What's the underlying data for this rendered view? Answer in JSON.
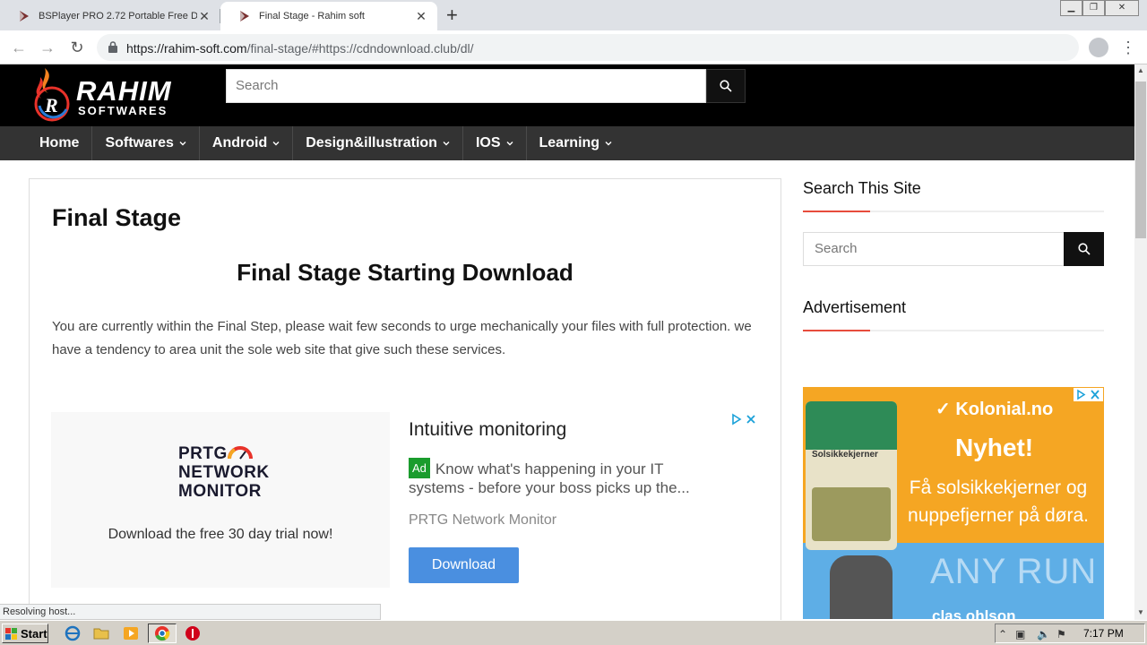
{
  "browser": {
    "tabs": [
      {
        "title": "BSPlayer PRO 2.72 Portable Free Do",
        "active": false
      },
      {
        "title": "Final Stage - Rahim soft",
        "active": true
      }
    ],
    "url_host": "https://rahim-soft.com",
    "url_rest": "/final-stage/#https://cdndownload.club/dl/",
    "status_text": "Resolving host..."
  },
  "site": {
    "logo_name": "RAHIM",
    "logo_sub": "SOFTWARES",
    "header_search_placeholder": "Search",
    "nav": [
      {
        "label": "Home",
        "has_dropdown": false
      },
      {
        "label": "Softwares",
        "has_dropdown": true
      },
      {
        "label": "Android",
        "has_dropdown": true
      },
      {
        "label": "Design&illustration",
        "has_dropdown": true
      },
      {
        "label": "IOS",
        "has_dropdown": true
      },
      {
        "label": "Learning",
        "has_dropdown": true
      }
    ]
  },
  "main": {
    "page_title": "Final Stage",
    "heading": "Final Stage Starting Download",
    "intro": "You are currently within the Final Step, please wait few seconds to urge mechanically your files with full protection. we have a tendency to area unit the sole web site that give such these services."
  },
  "ad": {
    "logo_line1": "PRTG",
    "logo_line2": "NETWORK",
    "logo_line3": "MONITOR",
    "trial_text": "Download the free 30 day trial now!",
    "headline": "Intuitive monitoring",
    "badge": "Ad",
    "body": "Know what's happening in your IT systems - before your boss picks up the...",
    "advertiser": "PRTG Network Monitor",
    "cta": "Download"
  },
  "sidebar": {
    "search_heading": "Search This Site",
    "search_placeholder": "Search",
    "ad_heading": "Advertisement",
    "banner": {
      "brand": "Kolonial.no",
      "headline": "Nyhet!",
      "text": "Få solsikkekjerner og nuppefjerner på døra.",
      "product_label": "Solsikkekjerner",
      "overlay": "ANY RUN",
      "footer": "clas ohlson"
    }
  },
  "taskbar": {
    "start_label": "Start",
    "clock": "7:17 PM"
  },
  "colors": {
    "header_bg": "#000000",
    "nav_bg": "#333333",
    "accent_red": "#e74c3c",
    "ad_button": "#4a8fe0",
    "banner_orange": "#f5a623",
    "banner_blue": "#5eaee6"
  }
}
